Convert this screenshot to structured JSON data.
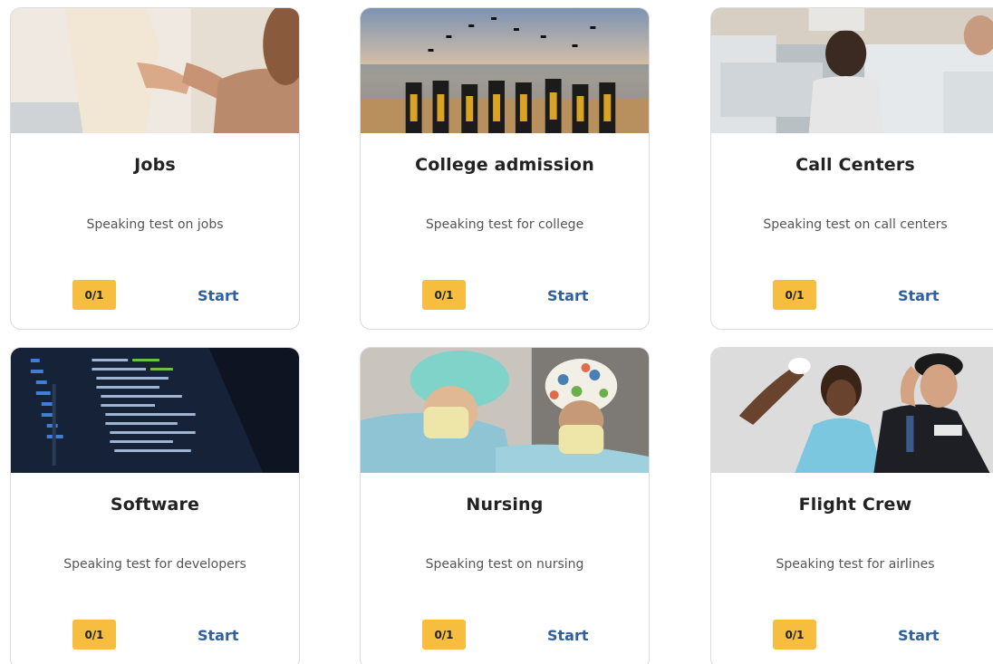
{
  "cards": [
    {
      "title": "Jobs",
      "description": "Speaking test on jobs",
      "progress": "0/1",
      "action": "Start",
      "image": "handshake-photo"
    },
    {
      "title": "College admission",
      "description": "Speaking test for college",
      "progress": "0/1",
      "action": "Start",
      "image": "graduation-photo"
    },
    {
      "title": "Call Centers",
      "description": "Speaking test on call centers",
      "progress": "0/1",
      "action": "Start",
      "image": "call-center-photo"
    },
    {
      "title": "Software",
      "description": "Speaking test for developers",
      "progress": "0/1",
      "action": "Start",
      "image": "code-screen-photo"
    },
    {
      "title": "Nursing",
      "description": "Speaking test on nursing",
      "progress": "0/1",
      "action": "Start",
      "image": "surgeons-photo"
    },
    {
      "title": "Flight Crew",
      "description": "Speaking test for airlines",
      "progress": "0/1",
      "action": "Start",
      "image": "flight-crew-photo"
    }
  ],
  "colors": {
    "badge": "#f6bd3f",
    "start_link": "#2f5f9e"
  }
}
